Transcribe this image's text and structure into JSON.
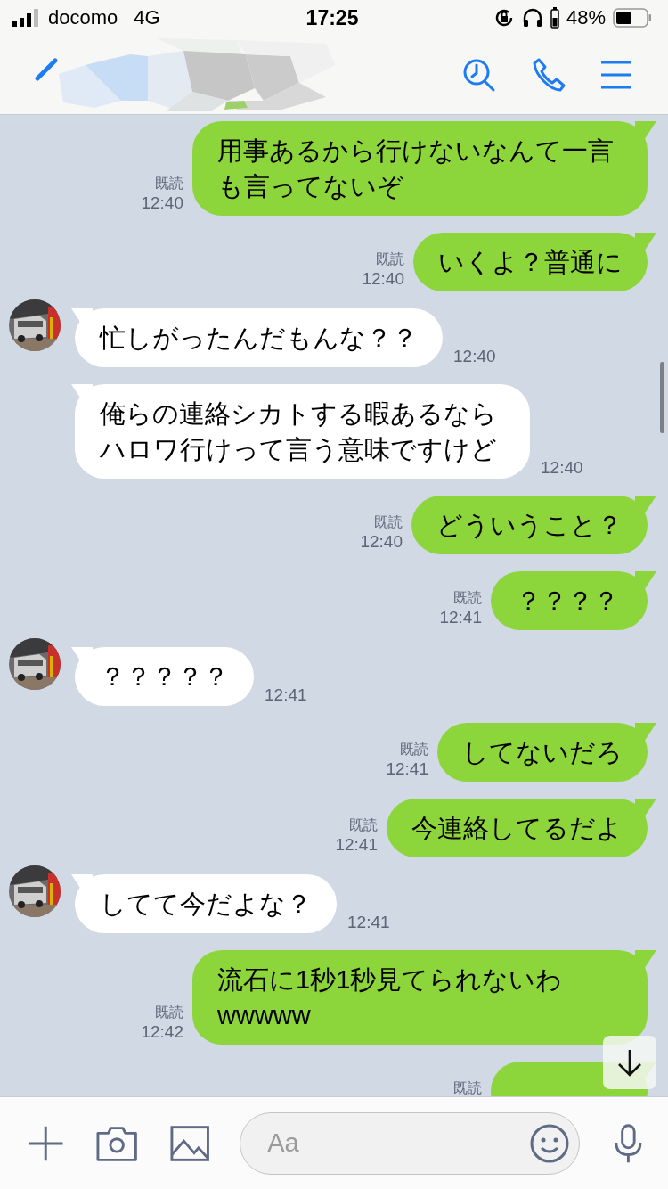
{
  "status_bar": {
    "carrier": "docomo",
    "network": "4G",
    "time": "17:25",
    "battery": "48%"
  },
  "messages": [
    {
      "kind": "sent",
      "text": "用事あるから行けないなんて一言も言ってないぞ",
      "read": "既読",
      "time": "12:40"
    },
    {
      "kind": "sent",
      "text": "いくよ？普通に",
      "read": "既読",
      "time": "12:40"
    },
    {
      "kind": "received",
      "avatar": true,
      "text": "忙しがったんだもんな？？",
      "time": "12:40"
    },
    {
      "kind": "received",
      "avatar": false,
      "text": "俺らの連絡シカトする暇あるならハロワ行けって言う意味ですけど",
      "time": "12:40"
    },
    {
      "kind": "sent",
      "text": "どういうこと？",
      "read": "既読",
      "time": "12:40"
    },
    {
      "kind": "sent",
      "text": "？？？？",
      "read": "既読",
      "time": "12:41"
    },
    {
      "kind": "received",
      "avatar": true,
      "text": "？？？？？",
      "time": "12:41"
    },
    {
      "kind": "sent",
      "text": "してないだろ",
      "read": "既読",
      "time": "12:41"
    },
    {
      "kind": "sent",
      "text": "今連絡してるだよ",
      "read": "既読",
      "time": "12:41"
    },
    {
      "kind": "received",
      "avatar": true,
      "text": "してて今だよな？",
      "time": "12:41"
    },
    {
      "kind": "sent",
      "text": "流石に1秒1秒見てられないわwwwww",
      "read": "既読",
      "time": "12:42"
    },
    {
      "kind": "sent",
      "read": "既読"
    }
  ],
  "input": {
    "placeholder": "Aa"
  }
}
